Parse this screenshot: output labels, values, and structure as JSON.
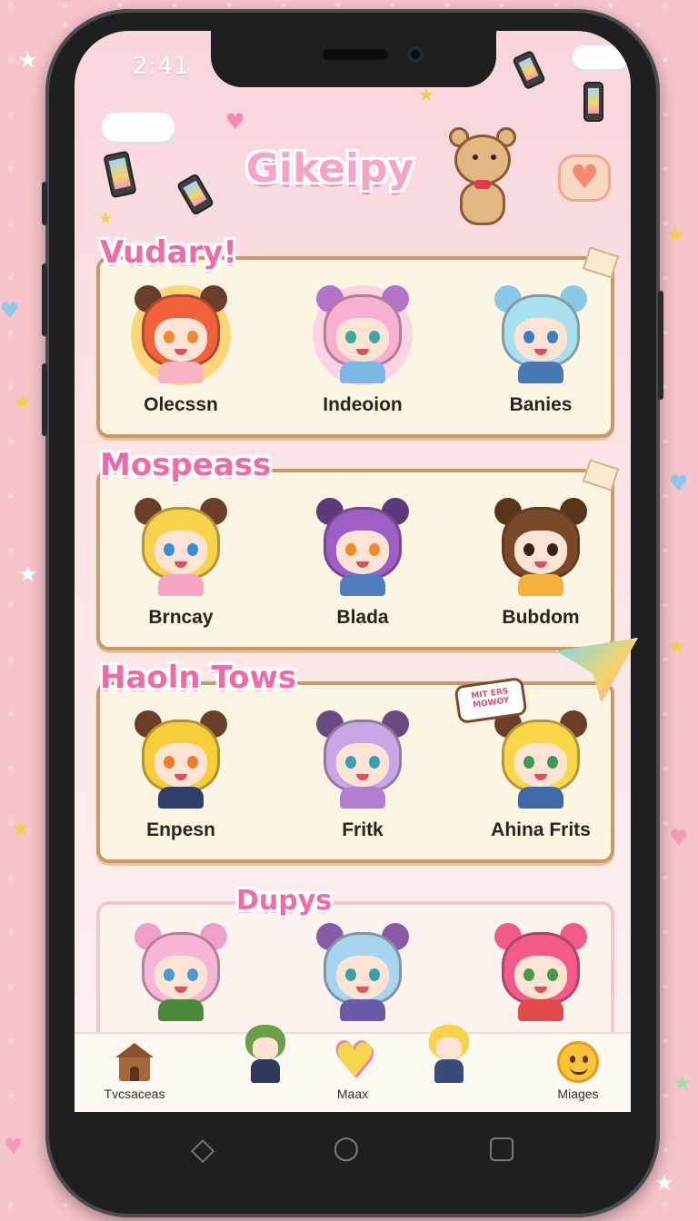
{
  "status": {
    "time": "2:41"
  },
  "app": {
    "title": "Gikeipy"
  },
  "sections": [
    {
      "title": "Vudary!",
      "characters": [
        {
          "name": "Olecssn",
          "hair": "#f2623a",
          "bg": "#fcd679",
          "eye": "#f08a2a",
          "shirt": "#f9b5c6",
          "ears": "#6b3e2a"
        },
        {
          "name": "Indeoion",
          "hair": "#f7b0d2",
          "bg": "#fbd3e3",
          "eye": "#3aa7a0",
          "shirt": "#7fb6e8",
          "ears": "#b373c7"
        },
        {
          "name": "Banies",
          "hair": "#a8e0f0",
          "bg": "transparent",
          "eye": "#3a7fc2",
          "shirt": "#4a77b5",
          "ears": "#8ac8e8"
        }
      ]
    },
    {
      "title": "Mospeass",
      "characters": [
        {
          "name": "Brncay",
          "hair": "#f8d24a",
          "bg": "transparent",
          "eye": "#3a8ed6",
          "shirt": "#f6a6c4",
          "ears": "#6b3e2a"
        },
        {
          "name": "Blada",
          "hair": "#9d5ec6",
          "bg": "transparent",
          "eye": "#f08a2a",
          "shirt": "#4f7cbf",
          "ears": "#5a3a7a"
        },
        {
          "name": "Bubdom",
          "hair": "#7a4a28",
          "bg": "transparent",
          "eye": "#3a2210",
          "shirt": "#f2b23c",
          "ears": "#5a3418"
        }
      ]
    },
    {
      "title": "Haoln Tows",
      "characters": [
        {
          "name": "Enpesn",
          "hair": "#f8cd3a",
          "bg": "transparent",
          "eye": "#f07a2a",
          "shirt": "#2f3f6a",
          "ears": "#6b3e2a"
        },
        {
          "name": "Fritk",
          "hair": "#c9a6e6",
          "bg": "transparent",
          "eye": "#3aa0b0",
          "shirt": "#b27fd0",
          "ears": "#6a4a80"
        },
        {
          "name": "Ahina Frits",
          "hair": "#f8d84a",
          "bg": "transparent",
          "eye": "#3a9a5a",
          "shirt": "#3f6aa8",
          "ears": "#6b3e2a"
        }
      ]
    },
    {
      "title": "Dupys",
      "characters": [
        {
          "name": "",
          "hair": "#f6b7d7",
          "bg": "transparent",
          "eye": "#4a9ad6",
          "shirt": "#4a8a3a",
          "ears": "#f0a0c8"
        },
        {
          "name": "",
          "hair": "#a7d4ef",
          "bg": "transparent",
          "eye": "#3aa0a8",
          "shirt": "#6a5aa8",
          "ears": "#8a5aa8"
        },
        {
          "name": "",
          "hair": "#f25a8a",
          "bg": "transparent",
          "eye": "#4a9a4a",
          "shirt": "#e04a4a",
          "ears": "#f25a8a"
        }
      ]
    }
  ],
  "nav": [
    {
      "label": "Tvcsaceas",
      "icon": "house-icon"
    },
    {
      "label": "",
      "icon": "green-hair-chibi-icon"
    },
    {
      "label": "Maax",
      "icon": "heart-icon"
    },
    {
      "label": "",
      "icon": "blonde-cat-chibi-icon"
    },
    {
      "label": "Miages",
      "icon": "smiley-face-icon"
    }
  ],
  "sign_text": "MIT ERS MOWOY",
  "colors": {
    "accent_pink": "#f06aa6",
    "card_border": "#c9996a",
    "card_bg": "#fdf5e3"
  }
}
